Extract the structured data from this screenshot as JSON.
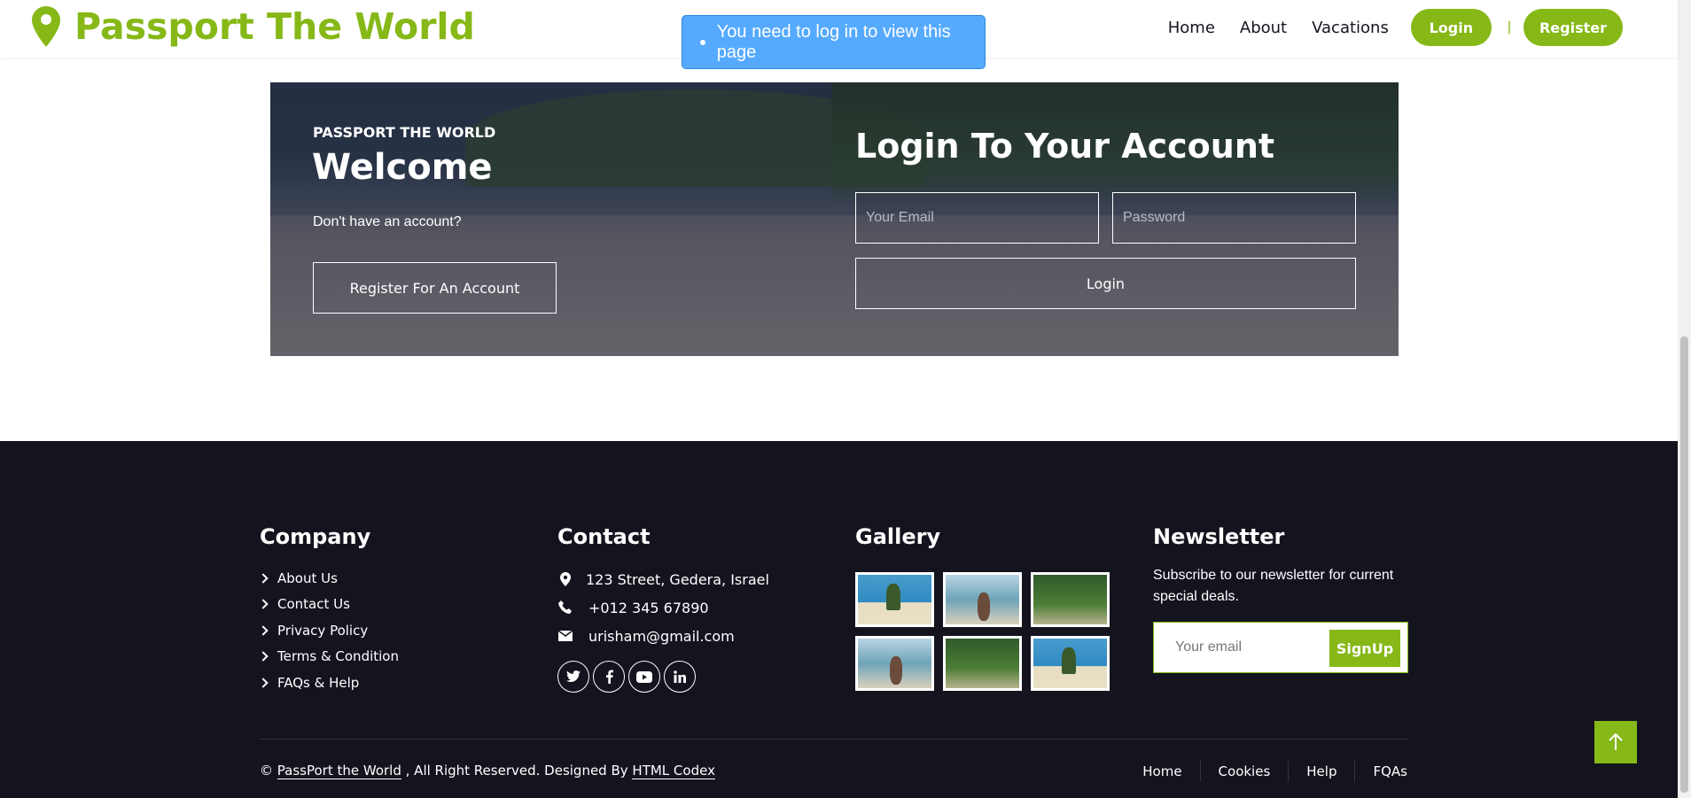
{
  "colors": {
    "accent": "#86b817",
    "footer_bg": "#14141f",
    "alert_bg": "#55aaff"
  },
  "navbar": {
    "brand": "Passport The World",
    "brand_icon": "map-pin-icon",
    "links": [
      "Home",
      "About",
      "Vacations"
    ],
    "login_label": "Login",
    "separator": "|",
    "register_label": "Register"
  },
  "alert": {
    "message": "You need to log in to view this page"
  },
  "hero": {
    "eyebrow": "PASSPORT THE WORLD",
    "welcome": "Welcome",
    "no_account": "Don't have an account?",
    "register_button": "Register For An Account",
    "login_title": "Login To Your Account",
    "email_placeholder": "Your Email",
    "password_placeholder": "Password",
    "login_button": "Login"
  },
  "footer": {
    "company": {
      "title": "Company",
      "links": [
        "About Us",
        "Contact Us",
        "Privacy Policy",
        "Terms & Condition",
        "FAQs & Help"
      ]
    },
    "contact": {
      "title": "Contact",
      "address": "123 Street, Gedera, Israel",
      "phone": "+012 345 67890",
      "email": "urisham@gmail.com",
      "socials": [
        "twitter-icon",
        "facebook-icon",
        "youtube-icon",
        "linkedin-icon"
      ]
    },
    "gallery": {
      "title": "Gallery"
    },
    "newsletter": {
      "title": "Newsletter",
      "text": "Subscribe to our newsletter for current special deals.",
      "placeholder": "Your email",
      "button": "SignUp"
    },
    "copyright": {
      "symbol": "©",
      "site_link": "PassPort the World",
      "middle": ", All Right Reserved. Designed By",
      "designer_link": "HTML Codex"
    },
    "menu": [
      "Home",
      "Cookies",
      "Help",
      "FQAs"
    ]
  }
}
